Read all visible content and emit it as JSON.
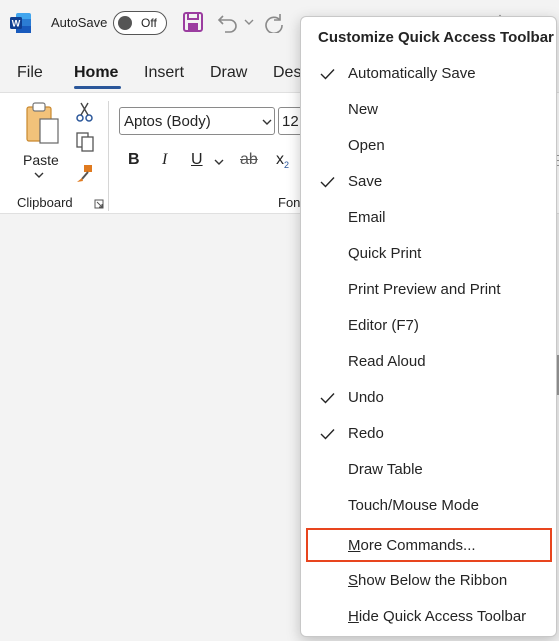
{
  "titlebar": {
    "autosave_label": "AutoSave",
    "autosave_state": "Off"
  },
  "tabs": [
    {
      "label": "File",
      "active": false
    },
    {
      "label": "Home",
      "active": true
    },
    {
      "label": "Insert",
      "active": false
    },
    {
      "label": "Draw",
      "active": false
    },
    {
      "label": "Des",
      "active": false
    }
  ],
  "ribbon": {
    "paste_label": "Paste",
    "clipboard_label": "Clipboard",
    "font_name": "Aptos (Body)",
    "font_size": "12",
    "font_group_label": "Fon",
    "bold": "B",
    "italic": "I",
    "underline": "U",
    "strikethrough": "ab",
    "subscript": "x"
  },
  "menu": {
    "title": "Customize Quick Access Toolbar",
    "items": [
      {
        "label": "Automatically Save",
        "checked": true
      },
      {
        "label": "New",
        "checked": false
      },
      {
        "label": "Open",
        "checked": false
      },
      {
        "label": "Save",
        "checked": true
      },
      {
        "label": "Email",
        "checked": false
      },
      {
        "label": "Quick Print",
        "checked": false
      },
      {
        "label": "Print Preview and Print",
        "checked": false
      },
      {
        "label": "Editor (F7)",
        "checked": false
      },
      {
        "label": "Read Aloud",
        "checked": false
      },
      {
        "label": "Undo",
        "checked": true
      },
      {
        "label": "Redo",
        "checked": true
      },
      {
        "label": "Draw Table",
        "checked": false
      },
      {
        "label": "Touch/Mouse Mode",
        "checked": false
      }
    ],
    "more_commands": {
      "key": "M",
      "rest": "ore Commands..."
    },
    "show_below": {
      "key": "S",
      "rest": "how Below the Ribbon"
    },
    "hide_toolbar": {
      "key": "H",
      "rest": "ide Quick Access Toolbar"
    }
  },
  "colors": {
    "word_blue": "#2b579a",
    "save_purple": "#9b3da0",
    "highlight_red": "#e8451e"
  }
}
